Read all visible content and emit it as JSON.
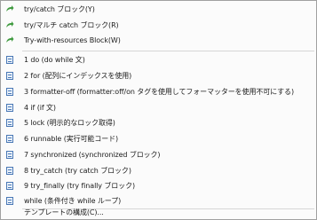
{
  "menu": {
    "blocks": [
      {
        "label": "try/catch ブロック(Y)",
        "icon": "green-arrow-icon"
      },
      {
        "label": "try/マルチ catch ブロック(R)",
        "icon": "green-arrow-icon"
      },
      {
        "label": "Try-with-resources Block(W)",
        "icon": "green-arrow-icon"
      }
    ],
    "templates": [
      {
        "label": "1 do (do while 文)",
        "icon": "template-icon"
      },
      {
        "label": "2 for (配列にインデックスを使用)",
        "icon": "template-icon"
      },
      {
        "label": "3 formatter-off (formatter:off/on タグを使用してフォーマッターを使用不可にする)",
        "icon": "template-icon"
      },
      {
        "label": "4 if (if 文)",
        "icon": "template-icon"
      },
      {
        "label": "5 lock (明示的なロック取得)",
        "icon": "template-icon"
      },
      {
        "label": "6 runnable (実行可能コード)",
        "icon": "template-icon"
      },
      {
        "label": "7 synchronized (synchronized ブロック)",
        "icon": "template-icon"
      },
      {
        "label": "8 try_catch (try catch ブロック)",
        "icon": "template-icon"
      },
      {
        "label": "9 try_finally (try finally ブロック)",
        "icon": "template-icon"
      },
      {
        "label": "while (条件付き while ループ)",
        "icon": "template-icon"
      }
    ],
    "configure": {
      "label": "テンプレートの構成(C)..."
    }
  },
  "colors": {
    "arrow": "#3f9a3f",
    "template_icon": "#4a78b5",
    "separator": "#d6d6d6"
  }
}
